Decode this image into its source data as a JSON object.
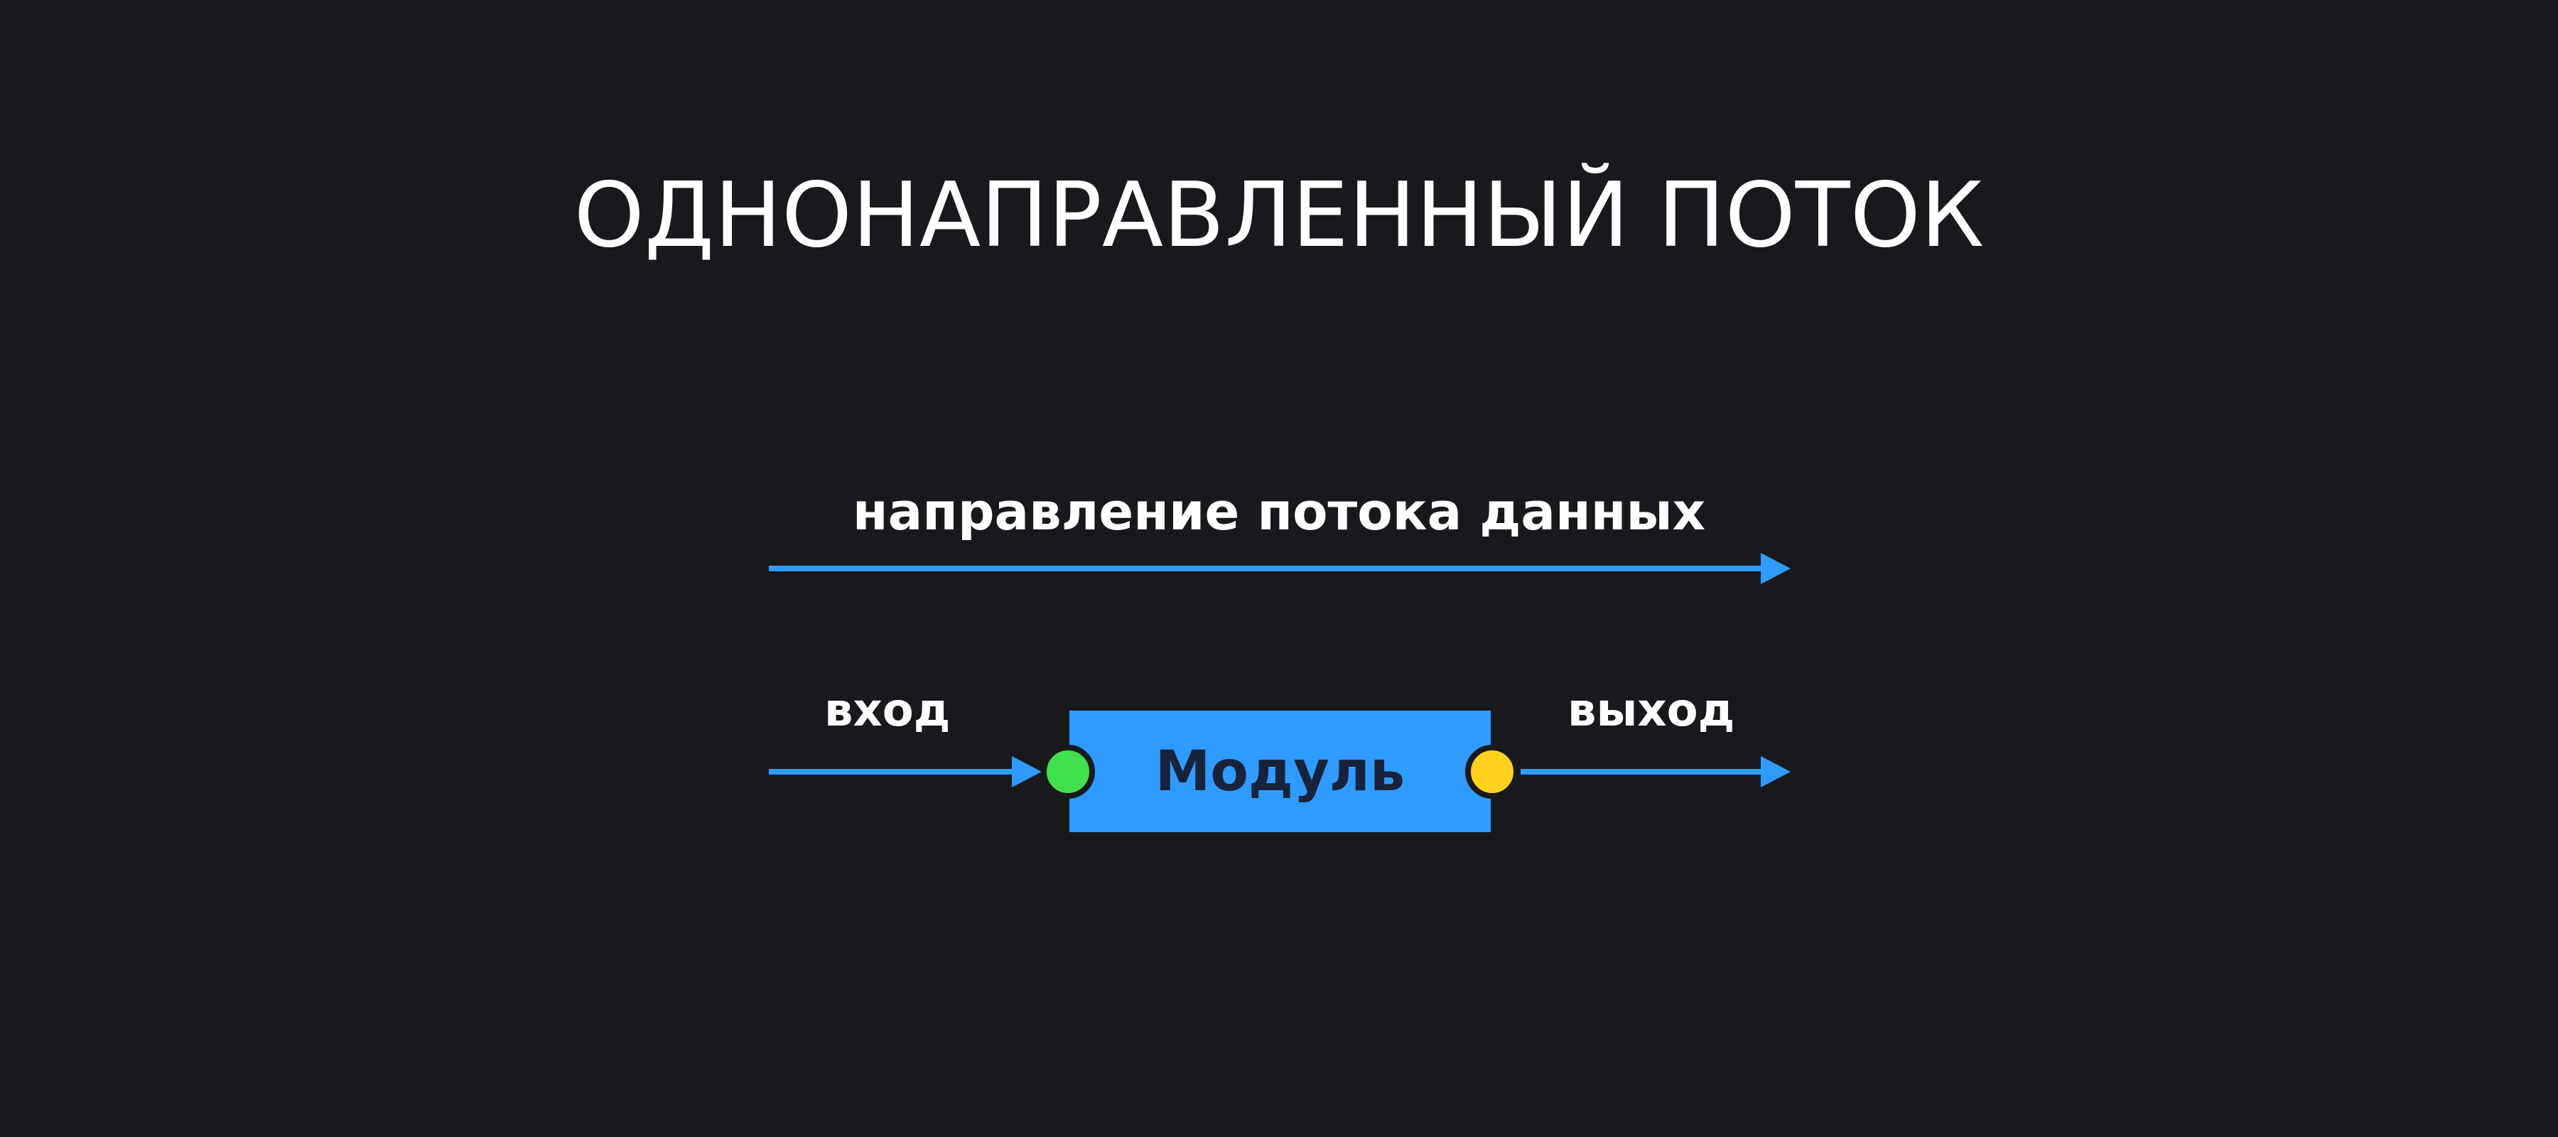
{
  "title": "ОДНОНАПРАВЛЕННЫЙ ПОТОК",
  "flow_label": "направление потока данных",
  "input_label": "вход",
  "output_label": "выход",
  "module_label": "Модуль",
  "colors": {
    "background": "#18191d",
    "text": "#ffffff",
    "arrow": "#2f9bff",
    "module_fill": "#2f9bff",
    "module_text": "#17233a",
    "input_port": "#3fe04b",
    "output_port": "#ffd21f",
    "port_outline": "#1a1a1a"
  }
}
